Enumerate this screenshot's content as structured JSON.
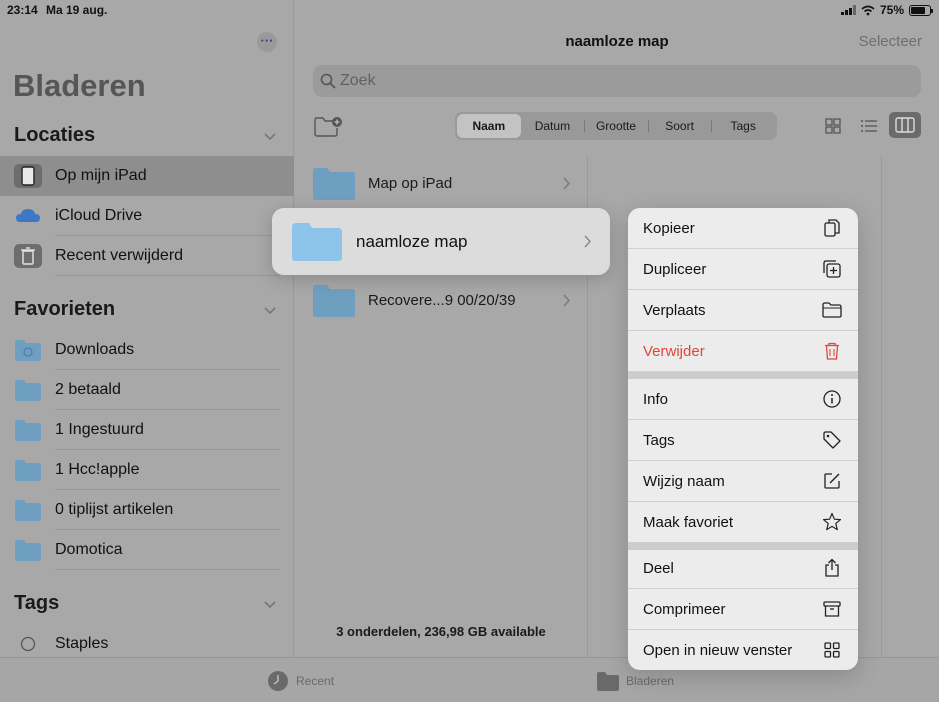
{
  "status": {
    "time": "23:14",
    "date": "Ma 19 aug.",
    "battery": "75%",
    "battery_level": 0.75
  },
  "sidebar": {
    "title": "Bladeren",
    "locations": {
      "header": "Locaties",
      "items": [
        {
          "label": "Op mijn iPad",
          "icon": "ipad-icon"
        },
        {
          "label": "iCloud Drive",
          "icon": "icloud-icon"
        },
        {
          "label": "Recent verwijderd",
          "icon": "trash-icon"
        }
      ]
    },
    "favorites": {
      "header": "Favorieten",
      "items": [
        {
          "label": "Downloads"
        },
        {
          "label": "2 betaald"
        },
        {
          "label": "1 Ingestuurd"
        },
        {
          "label": "1 Hcc!apple"
        },
        {
          "label": "0 tiplijst artikelen"
        },
        {
          "label": "Domotica"
        }
      ]
    },
    "tags": {
      "header": "Tags",
      "items": [
        {
          "label": "Staples"
        }
      ]
    }
  },
  "main": {
    "title": "naamloze map",
    "select_label": "Selecteer",
    "search_placeholder": "Zoek",
    "sort_options": [
      "Naam",
      "Datum",
      "Grootte",
      "Soort",
      "Tags"
    ],
    "sort_selected": "Naam",
    "files": [
      {
        "name": "Map op iPad"
      },
      {
        "name": "naamloze map"
      },
      {
        "name": "Recovere...9 00/20/39"
      }
    ],
    "footer": "3 onderdelen, 236,98 GB available"
  },
  "preview": {
    "name": "naamloze map"
  },
  "context_menu": {
    "groups": [
      [
        {
          "label": "Kopieer",
          "icon": "copy-icon"
        },
        {
          "label": "Dupliceer",
          "icon": "duplicate-icon"
        },
        {
          "label": "Verplaats",
          "icon": "folder-icon"
        },
        {
          "label": "Verwijder",
          "icon": "trash-icon",
          "destructive": true
        }
      ],
      [
        {
          "label": "Info",
          "icon": "info-icon"
        },
        {
          "label": "Tags",
          "icon": "tag-icon"
        },
        {
          "label": "Wijzig naam",
          "icon": "edit-icon"
        },
        {
          "label": "Maak favoriet",
          "icon": "star-icon"
        }
      ],
      [
        {
          "label": "Deel",
          "icon": "share-icon"
        },
        {
          "label": "Comprimeer",
          "icon": "archive-icon"
        },
        {
          "label": "Open in nieuw venster",
          "icon": "grid-icon"
        }
      ]
    ]
  },
  "tabbar": {
    "recent": "Recent",
    "browse": "Bladeren"
  },
  "colors": {
    "folder": "#7fb7dd",
    "destructive": "#e0453a",
    "accent": "#3b6fb5"
  }
}
